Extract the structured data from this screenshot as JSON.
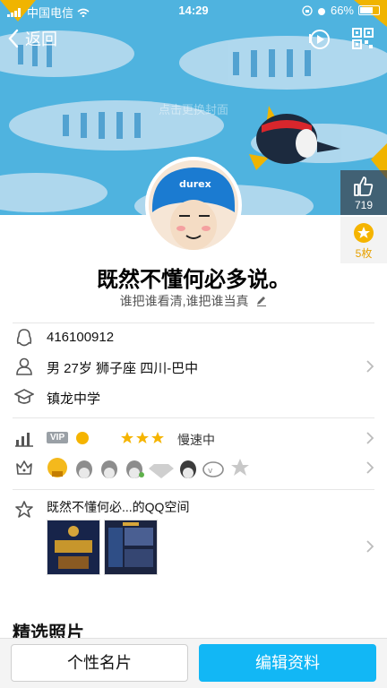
{
  "status_bar": {
    "carrier": "中国电信",
    "time": "14:29",
    "battery": "66%"
  },
  "nav": {
    "back_label": "返回"
  },
  "cover": {
    "hint": "点击更换封面"
  },
  "likes": {
    "count": "719"
  },
  "coins": {
    "count": "5枚"
  },
  "profile": {
    "nickname": "既然不懂何必多说。",
    "signature": "谁把谁看清,谁把谁当真",
    "avatar_text": "durex"
  },
  "info": {
    "qq_number": "416100912",
    "basic": "男 27岁 狮子座 四川-巴中",
    "school": "镇龙中学"
  },
  "level": {
    "vip_label": "VIP",
    "speed_text": "慢速中"
  },
  "qzone": {
    "title": "既然不懂何必...的QQ空间"
  },
  "photos": {
    "section_title": "精选照片"
  },
  "bottom": {
    "card_button": "个性名片",
    "edit_button": "编辑资料"
  },
  "icons": {
    "back": "chevron-left-icon",
    "music": "music-play-icon",
    "qr": "qr-code-icon",
    "like": "thumbs-up-icon",
    "coin": "star-coin-icon",
    "qq": "penguin-icon",
    "person": "person-icon",
    "school": "graduation-cap-icon",
    "level": "level-chart-icon",
    "badge": "crown-badge-icon",
    "zone": "star-icon"
  },
  "colors": {
    "accent": "#12b7f5",
    "cover": "#4fb3df",
    "like_bg": "#3c4650",
    "coin": "#e7a100"
  }
}
